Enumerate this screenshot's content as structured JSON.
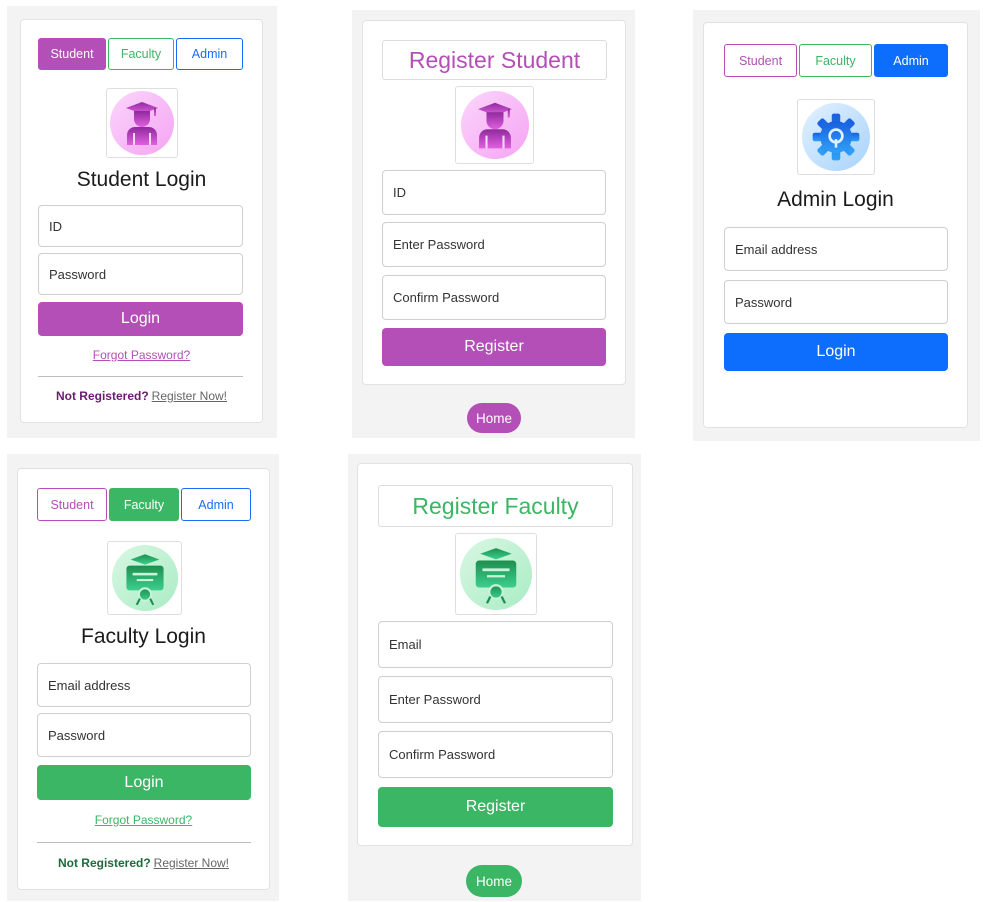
{
  "colors": {
    "student": "#b34fb6",
    "faculty": "#3bb664",
    "admin": "#0d6efd"
  },
  "tabs": {
    "student": "Student",
    "faculty": "Faculty",
    "admin": "Admin"
  },
  "student_login": {
    "title": "Student Login",
    "id_placeholder": "ID",
    "password_placeholder": "Password",
    "login_label": "Login",
    "forgot_label": "Forgot Password?",
    "not_registered": "Not Registered?",
    "register_now": "Register Now!",
    "icon": "graduate-student-icon"
  },
  "register_student": {
    "title": "Register Student",
    "id_placeholder": "ID",
    "password_placeholder": "Enter Password",
    "confirm_placeholder": "Confirm Password",
    "register_label": "Register",
    "home_label": "Home",
    "icon": "graduate-student-icon"
  },
  "admin_login": {
    "title": "Admin Login",
    "email_placeholder": "Email address",
    "password_placeholder": "Password",
    "login_label": "Login",
    "icon": "gear-admin-icon"
  },
  "faculty_login": {
    "title": "Faculty Login",
    "email_placeholder": "Email address",
    "password_placeholder": "Password",
    "login_label": "Login",
    "forgot_label": "Forgot Password?",
    "not_registered": "Not Registered?",
    "register_now": "Register Now!",
    "icon": "faculty-certificate-icon"
  },
  "register_faculty": {
    "title": "Register Faculty",
    "email_placeholder": "Email",
    "password_placeholder": "Enter Password",
    "confirm_placeholder": "Confirm Password",
    "register_label": "Register",
    "home_label": "Home",
    "icon": "faculty-certificate-icon"
  }
}
